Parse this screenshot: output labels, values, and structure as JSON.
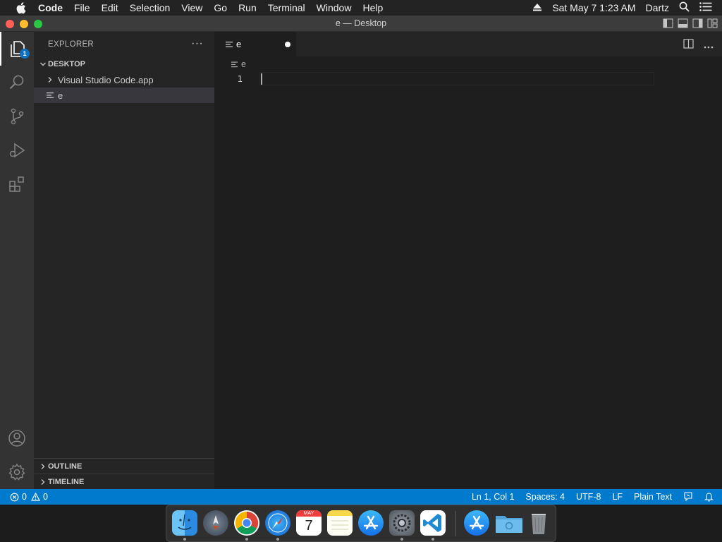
{
  "menubar": {
    "app_name": "Code",
    "items": [
      "File",
      "Edit",
      "Selection",
      "View",
      "Go",
      "Run",
      "Terminal",
      "Window",
      "Help"
    ],
    "datetime": "Sat May 7  1:23 AM",
    "user": "Dartz"
  },
  "window": {
    "title": "e — Desktop"
  },
  "activity_bar": {
    "explorer_badge": "1",
    "items": [
      "explorer",
      "search",
      "source-control",
      "run-and-debug",
      "extensions"
    ],
    "bottom_items": [
      "accounts",
      "manage"
    ]
  },
  "sidebar": {
    "header": "EXPLORER",
    "more": "···",
    "folder": "DESKTOP",
    "tree": [
      {
        "label": "Visual Studio Code.app",
        "type": "folder"
      },
      {
        "label": "e",
        "type": "file"
      }
    ],
    "outline": "OUTLINE",
    "timeline": "TIMELINE"
  },
  "editor": {
    "tab_label": "e",
    "breadcrumb": "e",
    "line_numbers": [
      "1"
    ]
  },
  "statusbar": {
    "errors": "0",
    "warnings": "0",
    "position": "Ln 1, Col 1",
    "indent": "Spaces: 4",
    "encoding": "UTF-8",
    "eol": "LF",
    "language": "Plain Text"
  },
  "dock": {
    "apps": [
      "Finder",
      "Launchpad",
      "Google Chrome",
      "Safari",
      "Calendar",
      "Notes",
      "App Store",
      "System Preferences",
      "Visual Studio Code",
      "App Store Downloads",
      "Downloads Folder",
      "Trash"
    ],
    "calendar_month": "MAY",
    "calendar_day": "7"
  },
  "colors": {
    "accent": "#007acc",
    "badge": "#0e70c0",
    "editor_bg": "#1e1e1e",
    "sidebar_bg": "#252526",
    "activity_bg": "#333333"
  }
}
